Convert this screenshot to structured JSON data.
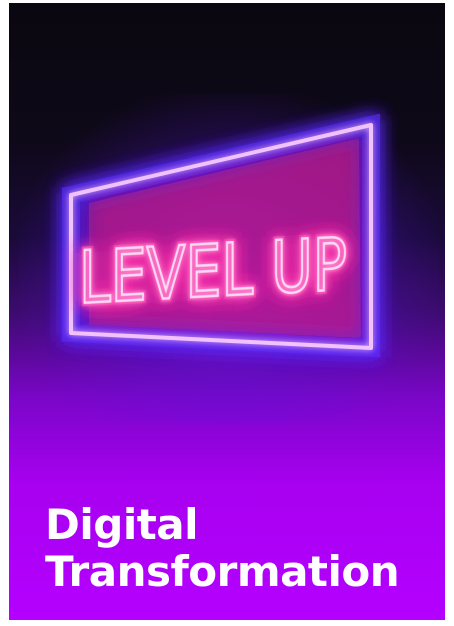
{
  "sign": {
    "text": "LEVEL UP",
    "tube_color": "#ff5fd0",
    "frame_color": "#f0b8ff",
    "glow_color": "#7a2cff"
  },
  "caption": {
    "line1": "Digital",
    "line2": "Transformation"
  },
  "colors": {
    "background_top": "#0a0710",
    "background_bottom": "#b400ff",
    "caption_text": "#ffffff"
  }
}
